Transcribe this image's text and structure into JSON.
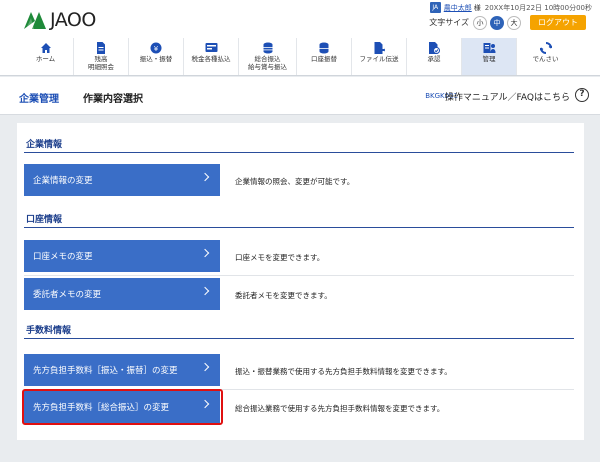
{
  "header": {
    "logo_text": "JAOO",
    "user_name": "農中太郎",
    "user_suffix": "様",
    "user_icon_label": "JA",
    "last_login": "20XX年10月22日 10時00分00秒",
    "font_size_label": "文字サイズ",
    "font_sizes": [
      "小",
      "中",
      "大"
    ],
    "font_size_active": "中",
    "logout_label": "ログアウト"
  },
  "nav": {
    "items": [
      {
        "label": "ホーム",
        "icon": "home-icon"
      },
      {
        "label": "残高\n明細照会",
        "icon": "document-icon"
      },
      {
        "label": "振込・振替",
        "icon": "yen-coin-icon"
      },
      {
        "label": "税金各種払込",
        "icon": "bill-icon"
      },
      {
        "label": "総合振込\n給与賞与振込",
        "icon": "coin-stack-icon"
      },
      {
        "label": "口座振替",
        "icon": "database-icon"
      },
      {
        "label": "ファイル伝送",
        "icon": "file-transfer-icon"
      },
      {
        "label": "承認",
        "icon": "approve-icon"
      },
      {
        "label": "管理",
        "icon": "admin-icon"
      },
      {
        "label": "でんさい",
        "icon": "densai-icon"
      }
    ],
    "active": "管理"
  },
  "titlebar": {
    "section": "企業管理",
    "page": "作業内容選択",
    "screen_id": "BKGK001",
    "manual_link": "操作マニュアル／FAQはこちら",
    "help_icon": "?"
  },
  "sections": [
    {
      "title": "企業情報",
      "items": [
        {
          "label": "企業情報の変更",
          "desc": "企業情報の照会、変更が可能です。"
        }
      ]
    },
    {
      "title": "口座情報",
      "items": [
        {
          "label": "口座メモの変更",
          "desc": "口座メモを変更できます。"
        },
        {
          "label": "委託者メモの変更",
          "desc": "委託者メモを変更できます。"
        }
      ]
    },
    {
      "title": "手数料情報",
      "items": [
        {
          "label": "先方負担手数料［振込・振替］の変更",
          "desc": "振込・振替業務で使用する先方負担手数料情報を変更できます。"
        },
        {
          "label": "先方負担手数料［総合振込］の変更",
          "desc": "総合振込業務で使用する先方負担手数料情報を変更できます。"
        }
      ]
    }
  ],
  "colors": {
    "accent": "#3a6ec7",
    "heading": "#1d3f8c",
    "logout": "#f5a300",
    "highlight": "#e01010"
  }
}
